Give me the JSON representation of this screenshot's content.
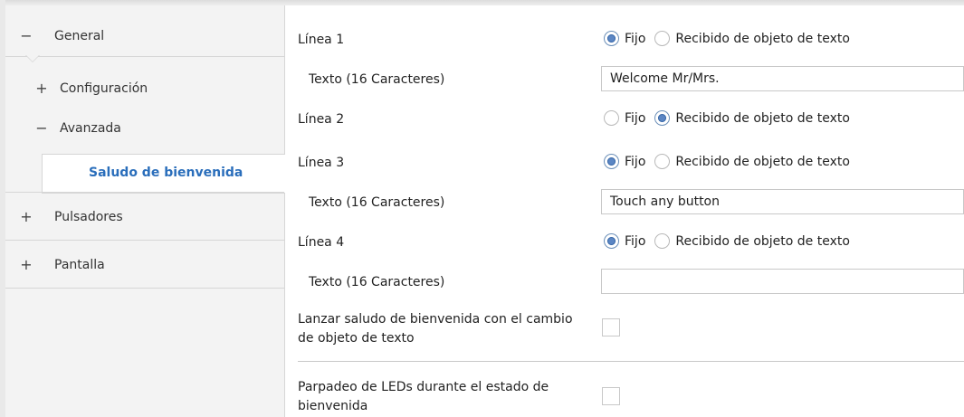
{
  "sidebar": {
    "items": [
      {
        "sign": "−",
        "label": "General"
      },
      {
        "sign": "+",
        "label": "Configuración"
      },
      {
        "sign": "−",
        "label": "Avanzada"
      },
      {
        "label": "Saludo de bienvenida"
      },
      {
        "sign": "+",
        "label": "Pulsadores"
      },
      {
        "sign": "+",
        "label": "Pantalla"
      }
    ]
  },
  "main": {
    "linea1": {
      "label": "Línea 1",
      "opt1": "Fijo",
      "opt2": "Recibido de objeto de texto",
      "selected": "opt1"
    },
    "texto1": {
      "label": "Texto (16 Caracteres)",
      "value": "Welcome Mr/Mrs."
    },
    "linea2": {
      "label": "Línea 2",
      "opt1": "Fijo",
      "opt2": "Recibido de objeto de texto",
      "selected": "opt2"
    },
    "linea3": {
      "label": "Línea 3",
      "opt1": "Fijo",
      "opt2": "Recibido de objeto de texto",
      "selected": "opt1"
    },
    "texto3": {
      "label": "Texto (16 Caracteres)",
      "value": "Touch any button"
    },
    "linea4": {
      "label": "Línea 4",
      "opt1": "Fijo",
      "opt2": "Recibido de objeto de texto",
      "selected": "opt1"
    },
    "texto4": {
      "label": "Texto (16 Caracteres)",
      "value": ""
    },
    "lanzar": {
      "line1": "Lanzar saludo de bienvenida con el cambio",
      "line2": "de objeto de texto",
      "checked": false
    },
    "parpadeo": {
      "line1": "Parpadeo de LEDs durante el estado de",
      "line2": "bienvenida",
      "checked": false
    }
  },
  "colors": {
    "accent": "#2a6ebb",
    "radio_selected": "#5b86c4"
  }
}
